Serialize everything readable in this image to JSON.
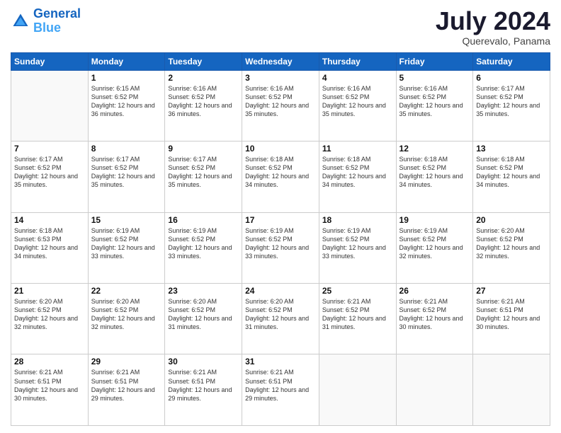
{
  "header": {
    "logo": "GeneralBlue",
    "month": "July 2024",
    "location": "Querevalo, Panama"
  },
  "weekdays": [
    "Sunday",
    "Monday",
    "Tuesday",
    "Wednesday",
    "Thursday",
    "Friday",
    "Saturday"
  ],
  "weeks": [
    [
      {
        "day": "",
        "sunrise": "",
        "sunset": "",
        "daylight": ""
      },
      {
        "day": "1",
        "sunrise": "6:15 AM",
        "sunset": "6:52 PM",
        "daylight": "12 hours and 36 minutes."
      },
      {
        "day": "2",
        "sunrise": "6:16 AM",
        "sunset": "6:52 PM",
        "daylight": "12 hours and 36 minutes."
      },
      {
        "day": "3",
        "sunrise": "6:16 AM",
        "sunset": "6:52 PM",
        "daylight": "12 hours and 35 minutes."
      },
      {
        "day": "4",
        "sunrise": "6:16 AM",
        "sunset": "6:52 PM",
        "daylight": "12 hours and 35 minutes."
      },
      {
        "day": "5",
        "sunrise": "6:16 AM",
        "sunset": "6:52 PM",
        "daylight": "12 hours and 35 minutes."
      },
      {
        "day": "6",
        "sunrise": "6:17 AM",
        "sunset": "6:52 PM",
        "daylight": "12 hours and 35 minutes."
      }
    ],
    [
      {
        "day": "7",
        "sunrise": "6:17 AM",
        "sunset": "6:52 PM",
        "daylight": "12 hours and 35 minutes."
      },
      {
        "day": "8",
        "sunrise": "6:17 AM",
        "sunset": "6:52 PM",
        "daylight": "12 hours and 35 minutes."
      },
      {
        "day": "9",
        "sunrise": "6:17 AM",
        "sunset": "6:52 PM",
        "daylight": "12 hours and 35 minutes."
      },
      {
        "day": "10",
        "sunrise": "6:18 AM",
        "sunset": "6:52 PM",
        "daylight": "12 hours and 34 minutes."
      },
      {
        "day": "11",
        "sunrise": "6:18 AM",
        "sunset": "6:52 PM",
        "daylight": "12 hours and 34 minutes."
      },
      {
        "day": "12",
        "sunrise": "6:18 AM",
        "sunset": "6:52 PM",
        "daylight": "12 hours and 34 minutes."
      },
      {
        "day": "13",
        "sunrise": "6:18 AM",
        "sunset": "6:52 PM",
        "daylight": "12 hours and 34 minutes."
      }
    ],
    [
      {
        "day": "14",
        "sunrise": "6:18 AM",
        "sunset": "6:53 PM",
        "daylight": "12 hours and 34 minutes."
      },
      {
        "day": "15",
        "sunrise": "6:19 AM",
        "sunset": "6:52 PM",
        "daylight": "12 hours and 33 minutes."
      },
      {
        "day": "16",
        "sunrise": "6:19 AM",
        "sunset": "6:52 PM",
        "daylight": "12 hours and 33 minutes."
      },
      {
        "day": "17",
        "sunrise": "6:19 AM",
        "sunset": "6:52 PM",
        "daylight": "12 hours and 33 minutes."
      },
      {
        "day": "18",
        "sunrise": "6:19 AM",
        "sunset": "6:52 PM",
        "daylight": "12 hours and 33 minutes."
      },
      {
        "day": "19",
        "sunrise": "6:19 AM",
        "sunset": "6:52 PM",
        "daylight": "12 hours and 32 minutes."
      },
      {
        "day": "20",
        "sunrise": "6:20 AM",
        "sunset": "6:52 PM",
        "daylight": "12 hours and 32 minutes."
      }
    ],
    [
      {
        "day": "21",
        "sunrise": "6:20 AM",
        "sunset": "6:52 PM",
        "daylight": "12 hours and 32 minutes."
      },
      {
        "day": "22",
        "sunrise": "6:20 AM",
        "sunset": "6:52 PM",
        "daylight": "12 hours and 32 minutes."
      },
      {
        "day": "23",
        "sunrise": "6:20 AM",
        "sunset": "6:52 PM",
        "daylight": "12 hours and 31 minutes."
      },
      {
        "day": "24",
        "sunrise": "6:20 AM",
        "sunset": "6:52 PM",
        "daylight": "12 hours and 31 minutes."
      },
      {
        "day": "25",
        "sunrise": "6:21 AM",
        "sunset": "6:52 PM",
        "daylight": "12 hours and 31 minutes."
      },
      {
        "day": "26",
        "sunrise": "6:21 AM",
        "sunset": "6:52 PM",
        "daylight": "12 hours and 30 minutes."
      },
      {
        "day": "27",
        "sunrise": "6:21 AM",
        "sunset": "6:51 PM",
        "daylight": "12 hours and 30 minutes."
      }
    ],
    [
      {
        "day": "28",
        "sunrise": "6:21 AM",
        "sunset": "6:51 PM",
        "daylight": "12 hours and 30 minutes."
      },
      {
        "day": "29",
        "sunrise": "6:21 AM",
        "sunset": "6:51 PM",
        "daylight": "12 hours and 29 minutes."
      },
      {
        "day": "30",
        "sunrise": "6:21 AM",
        "sunset": "6:51 PM",
        "daylight": "12 hours and 29 minutes."
      },
      {
        "day": "31",
        "sunrise": "6:21 AM",
        "sunset": "6:51 PM",
        "daylight": "12 hours and 29 minutes."
      },
      {
        "day": "",
        "sunrise": "",
        "sunset": "",
        "daylight": ""
      },
      {
        "day": "",
        "sunrise": "",
        "sunset": "",
        "daylight": ""
      },
      {
        "day": "",
        "sunrise": "",
        "sunset": "",
        "daylight": ""
      }
    ]
  ]
}
